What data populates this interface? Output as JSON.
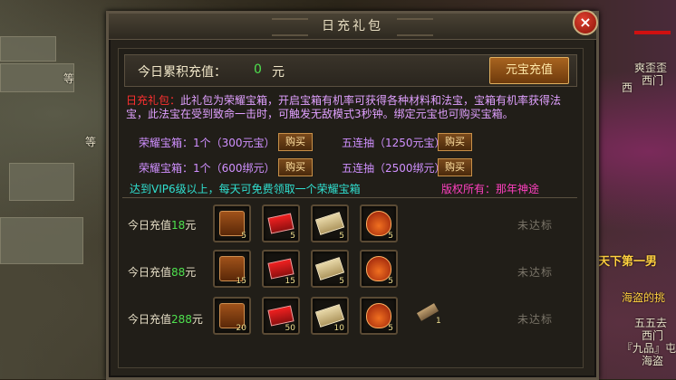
{
  "scene": {
    "npc_names": [
      "等",
      "等",
      "爽歪歪",
      "西门",
      "西",
      "天下第一男",
      "海盗的挑",
      "五五去",
      "西门",
      "『九品』屯",
      "海盗"
    ]
  },
  "dialog": {
    "title": "日充礼包",
    "close_label": "×",
    "summary": {
      "label": "今日累积充值：",
      "value": "0",
      "unit": "元",
      "recharge_button": "元宝充值"
    },
    "description": {
      "prefix": "日充礼包：",
      "text": "此礼包为荣耀宝箱，开启宝箱有机率可获得各种材料和法宝，宝箱有机率获得法宝，此法宝在受到致命一击时，可触发无敌模式3秒钟。绑定元宝也可购买宝箱。"
    },
    "purchases": [
      {
        "label": "荣耀宝箱：1个（300元宝）",
        "button": "购买"
      },
      {
        "label": "五连抽（1250元宝）",
        "button": "购买"
      },
      {
        "label": "荣耀宝箱：1个（600绑元）",
        "button": "购买"
      },
      {
        "label": "五连抽（2500绑元）",
        "button": "购买"
      }
    ],
    "vip_note": "达到VIP6级以上，每天可免费领取一个荣耀宝箱",
    "copyright": "版权所有：那年神途",
    "tiers": [
      {
        "label_prefix": "今日充值",
        "amount": "18",
        "unit": "元",
        "counts": [
          "5",
          "5",
          "5",
          "5"
        ],
        "extra": "",
        "status": "未达标"
      },
      {
        "label_prefix": "今日充值",
        "amount": "88",
        "unit": "元",
        "counts": [
          "15",
          "15",
          "5",
          "5"
        ],
        "extra": "",
        "status": "未达标"
      },
      {
        "label_prefix": "今日充值",
        "amount": "288",
        "unit": "元",
        "counts": [
          "20",
          "50",
          "10",
          "5"
        ],
        "extra": "1",
        "status": "未达标"
      }
    ],
    "item_icons": [
      "chest-icon",
      "red-envelope-icon",
      "scroll-icon",
      "bag-icon"
    ]
  }
}
